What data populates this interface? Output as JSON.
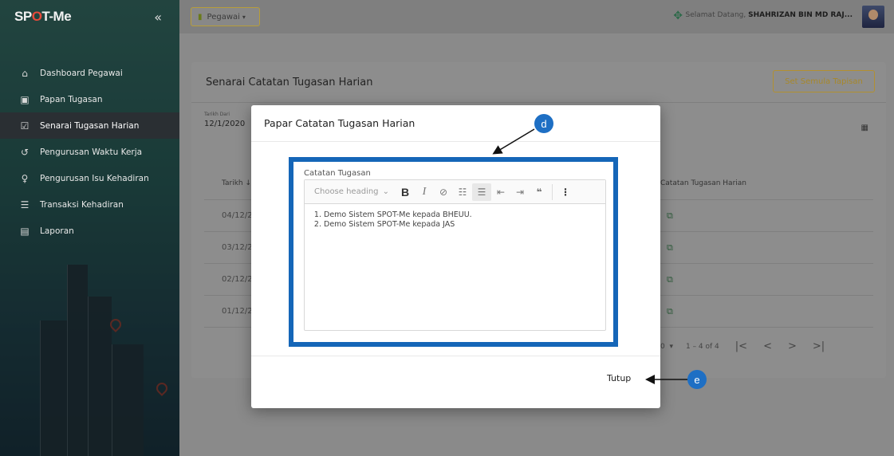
{
  "sidebar": {
    "logo": "SPOT-Me",
    "collapse_icon": "double-chevron-left",
    "items": [
      {
        "label": "Dashboard Pegawai",
        "icon": "home-icon",
        "active": false
      },
      {
        "label": "Papan Tugasan",
        "icon": "clipboard-icon",
        "active": false
      },
      {
        "label": "Senarai Tugasan Harian",
        "icon": "edit-list-icon",
        "active": true
      },
      {
        "label": "Pengurusan Waktu Kerja",
        "icon": "clock-icon",
        "active": false
      },
      {
        "label": "Pengurusan Isu Kehadiran",
        "icon": "user-icon",
        "active": false
      },
      {
        "label": "Transaksi Kehadiran",
        "icon": "list-icon",
        "active": false
      },
      {
        "label": "Laporan",
        "icon": "report-icon",
        "active": false
      }
    ]
  },
  "topbar": {
    "role_button": "Pegawai",
    "welcome_prefix": "Selamat Datang,",
    "user_name": "SHAHRIZAN BIN MD RAJ..."
  },
  "card": {
    "title": "Senarai Catatan Tugasan Harian",
    "reset_button": "Set Semula Tapisan",
    "date_label": "Tarikh Dari",
    "date_value": "12/1/2020",
    "col_tarikh": "Tarikh",
    "col_catatan": "Catatan Tugasan Harian",
    "rows": [
      "04/12/2",
      "03/12/2",
      "02/12/2",
      "01/12/2"
    ],
    "pager": {
      "per_page": "0",
      "range": "1 – 4 of 4"
    }
  },
  "modal": {
    "title": "Papar Catatan Tugasan Harian",
    "editor_label": "Catatan Tugasan",
    "heading_placeholder": "Choose heading",
    "content": [
      "Demo Sistem SPOT-Me kepada BHEUU.",
      "Demo Sistem SPOT-Me kepada JAS"
    ],
    "close_button": "Tutup"
  },
  "callouts": {
    "d": "d",
    "e": "e"
  },
  "colors": {
    "accent": "#1566b8",
    "callout": "#1e6fc4",
    "gold": "#a7882a"
  }
}
